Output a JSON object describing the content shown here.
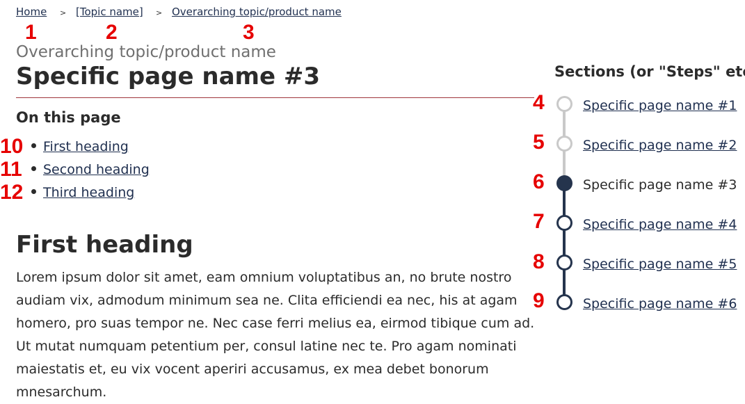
{
  "breadcrumb": {
    "items": [
      "Home",
      "[Topic name]",
      "Overarching topic/product name"
    ],
    "separator": ">"
  },
  "annotations": [
    "1",
    "2",
    "3",
    "4",
    "5",
    "6",
    "7",
    "8",
    "9",
    "10",
    "11",
    "12"
  ],
  "supertitle": "Overarching topic/product name",
  "page_title": "Specific page name #3",
  "toc": {
    "title": "On this page",
    "items": [
      "First heading",
      "Second heading",
      "Third heading"
    ]
  },
  "section": {
    "heading": "First heading",
    "body": "Lorem ipsum dolor sit amet, eam omnium voluptatibus an, no brute nostro audiam vix, admodum minimum sea ne. Clita efficiendi ea nec, his at agam homero, pro suas tempor ne. Nec case ferri melius ea, eirmod tibique cum ad. Ut mutat numquam petentium per, consul latine nec te. Pro agam nominati maiestatis et, eu vix vocent aperiri accusamus, ex mea debet bonorum mnesarchum."
  },
  "steps": {
    "title": "Sections (or \"Steps\" etc.)",
    "items": [
      {
        "label": "Specific page name #1",
        "state": "visited"
      },
      {
        "label": "Specific page name #2",
        "state": "visited"
      },
      {
        "label": "Specific page name #3",
        "state": "current"
      },
      {
        "label": "Specific page name #4",
        "state": "upcoming"
      },
      {
        "label": "Specific page name #5",
        "state": "upcoming"
      },
      {
        "label": "Specific page name #6",
        "state": "upcoming"
      }
    ]
  },
  "colors": {
    "annotation": "#e60000",
    "link": "#1f2f4f",
    "current_step": "#25344d",
    "visited_step": "#c9c9c9",
    "title_rule": "#a0353a"
  }
}
